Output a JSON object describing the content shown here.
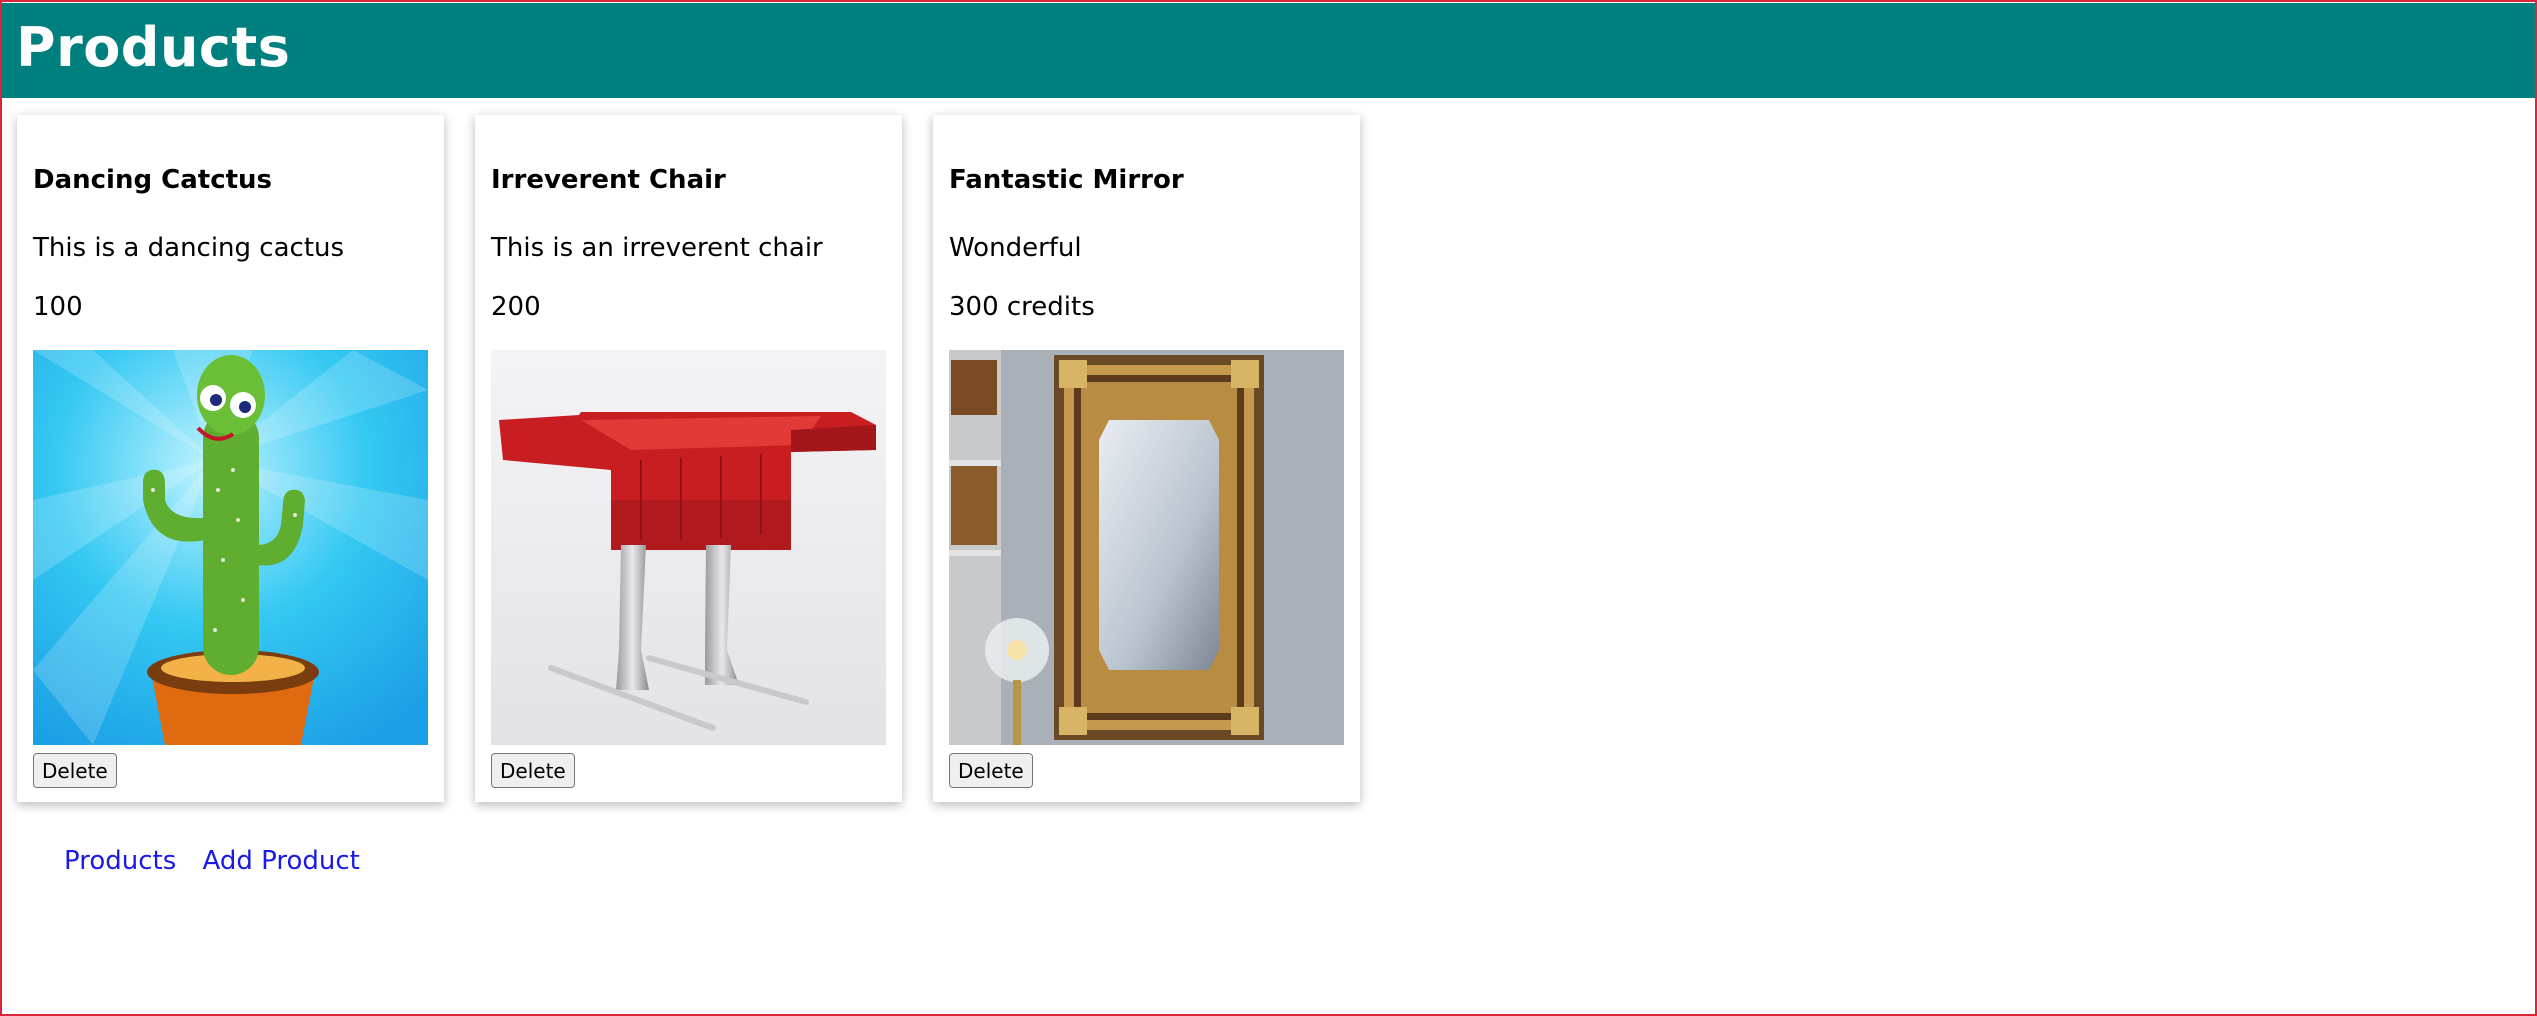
{
  "header": {
    "title": "Products"
  },
  "products": [
    {
      "name": "Dancing Catctus",
      "description": "This is a dancing cactus",
      "price": "100",
      "delete_label": "Delete",
      "image": "dancing-cactus-image"
    },
    {
      "name": "Irreverent Chair",
      "description": "This is an irreverent chair",
      "price": "200",
      "delete_label": "Delete",
      "image": "red-chair-with-legs-image"
    },
    {
      "name": "Fantastic Mirror",
      "description": "Wonderful",
      "price": "300 credits",
      "delete_label": "Delete",
      "image": "ornate-gold-mirror-image"
    }
  ],
  "nav": {
    "products_link": "Products",
    "add_product_link": "Add Product"
  },
  "colors": {
    "header_bg": "#007f7f",
    "link": "#1a1ae6",
    "frame_border": "#d9263a"
  }
}
